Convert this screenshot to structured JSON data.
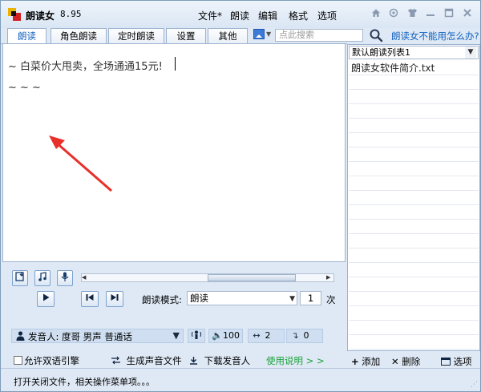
{
  "titlebar": {
    "app_name": "朗读女",
    "version": "8.95",
    "menu": [
      "文件*",
      "朗读",
      "编辑",
      "格式",
      "选项"
    ],
    "icons": [
      "home-icon",
      "settings-icon",
      "shirt-icon",
      "minimize-icon",
      "maximize-icon",
      "close-icon"
    ]
  },
  "tabs": [
    {
      "label": "朗读",
      "active": true
    },
    {
      "label": "角色朗读",
      "active": false
    },
    {
      "label": "定时朗读",
      "active": false
    },
    {
      "label": "设置",
      "active": false
    },
    {
      "label": "其他",
      "active": false
    }
  ],
  "search": {
    "placeholder": "点此搜索"
  },
  "help_link": "朗读女不能用怎么办?",
  "editor": {
    "line1": "~ 白菜价大甩卖，全场通通15元! ",
    "line2": "~ ~ ~"
  },
  "playlist": {
    "selected_list": "默认朗读列表1",
    "items": [
      "朗读女软件简介.txt"
    ]
  },
  "playback": {
    "read_mode_label": "朗读模式:",
    "read_mode_value": "朗读",
    "repeat_count": "1",
    "repeat_unit": "次"
  },
  "voice": {
    "speaker_label": "发音人: 度哥 男声 普通话",
    "volume": "100",
    "speed": "2",
    "pitch": "0"
  },
  "bottom": {
    "bilingual_label": "允许双语引擎",
    "bilingual_checked": false,
    "generate_audio": "生成声音文件",
    "download_voice": "下载发音人",
    "usage_link": "使用说明 > >",
    "add": "添加",
    "delete": "删除",
    "options": "选项"
  },
  "status": "打开关闭文件，相关操作菜单项。。。"
}
